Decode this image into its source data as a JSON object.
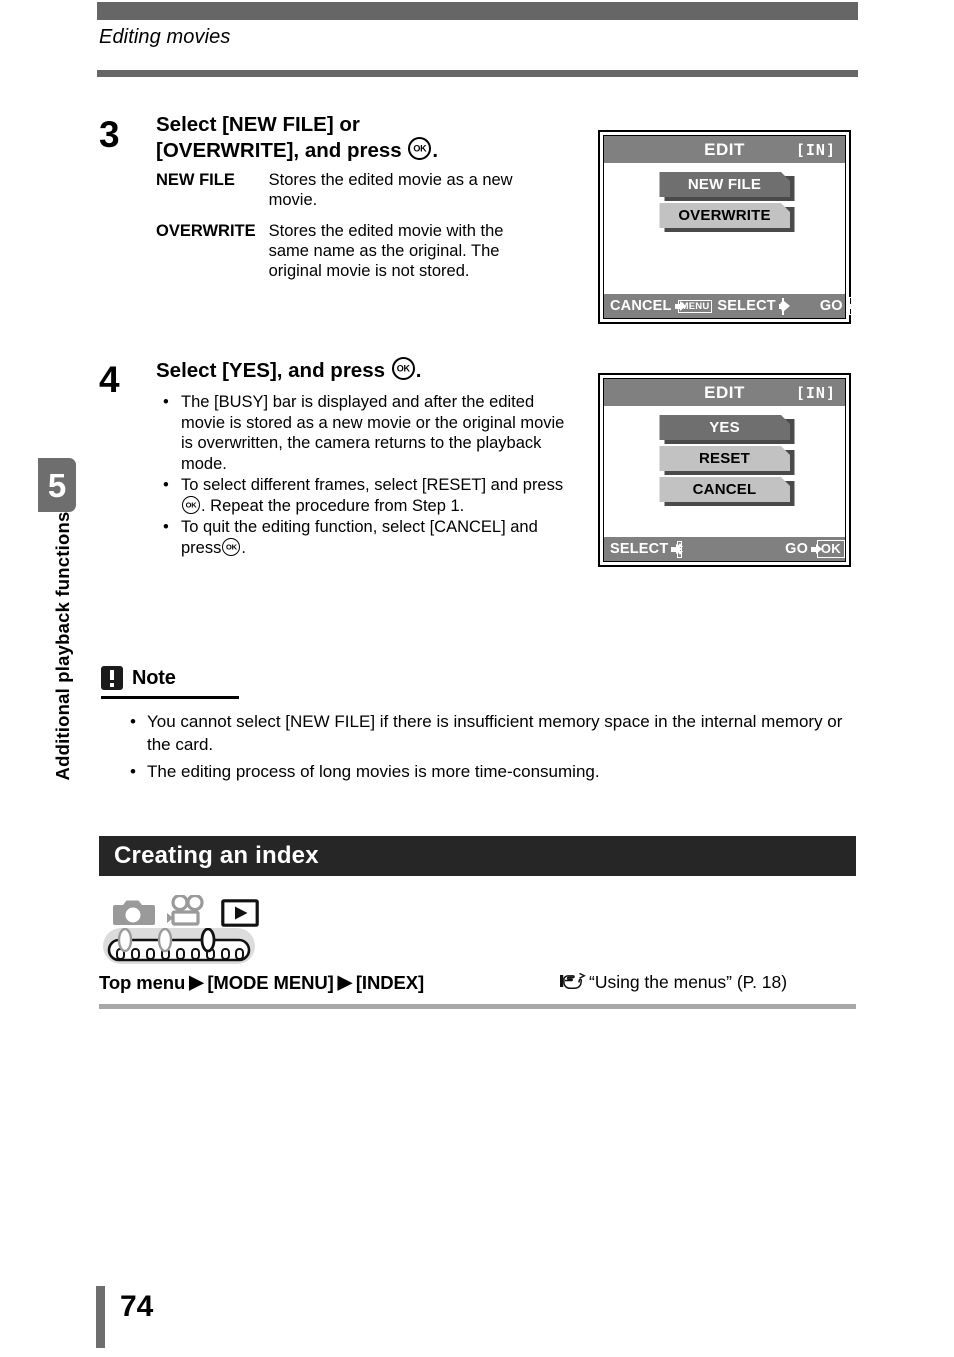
{
  "header": {
    "running_head": "Editing movies"
  },
  "sidebar": {
    "chapter_number": "5",
    "chapter_label": "Additional playback functions"
  },
  "steps": [
    {
      "number": "3",
      "title_line1": "Select [NEW FILE] or",
      "title_line2_a": "[OVERWRITE], and press",
      "title_line2_b": ".",
      "definitions": [
        {
          "term": "NEW FILE",
          "desc": "Stores the edited movie as a new movie."
        },
        {
          "term": "OVERWRITE",
          "desc": "Stores the edited movie with the same name as the original. The original movie is not stored."
        }
      ]
    },
    {
      "number": "4",
      "title_a": "Select [YES], and press",
      "title_b": ".",
      "bullets": [
        "The [BUSY] bar is displayed and after the edited movie is stored as a new movie or the original movie is overwritten, the camera returns to the playback mode.",
        "To select different frames, select [RESET] and press ⒪. Repeat the procedure from Step 1.",
        "To quit the editing function, select [CANCEL] and press ⒪."
      ],
      "bullet2_pre": "To select different frames, select [RESET] and press",
      "bullet2_post": ". Repeat the procedure from Step 1.",
      "bullet3_pre": "To quit the editing function, select [CANCEL] and press",
      "bullet3_post": "."
    }
  ],
  "lcd_screens": [
    {
      "title": "EDIT",
      "memory_indicator": "[IN]",
      "items": [
        {
          "label": "NEW FILE",
          "selected": true
        },
        {
          "label": "OVERWRITE",
          "selected": false
        }
      ],
      "status": {
        "cancel_label": "CANCEL",
        "menu_badge": "MENU",
        "select_label": "SELECT",
        "go_label": "GO",
        "ok_badge": "OK"
      }
    },
    {
      "title": "EDIT",
      "memory_indicator": "[IN]",
      "items": [
        {
          "label": "YES",
          "selected": true
        },
        {
          "label": "RESET",
          "selected": false
        },
        {
          "label": "CANCEL",
          "selected": false
        }
      ],
      "status": {
        "select_label": "SELECT",
        "go_label": "GO",
        "ok_badge": "OK"
      }
    }
  ],
  "note": {
    "title": "Note",
    "bullets": [
      "You cannot select [NEW FILE] if there is insufficient memory space in the internal memory or the card.",
      "The editing process of long movies is more time-consuming."
    ]
  },
  "section": {
    "heading": "Creating an index",
    "mode_icons": [
      "still-camera-icon",
      "movie-camera-icon",
      "playback-icon"
    ],
    "menu_path_1": "Top menu",
    "menu_path_2": "[MODE MENU]",
    "menu_path_3": "[INDEX]",
    "reference": "“Using the menus” (P. 18)"
  },
  "footer": {
    "page_number": "74"
  },
  "colors": {
    "rule_dark": "#666666",
    "rule_light": "#a8a8a8",
    "section_bar": "#262626",
    "lcd_title_gray": "#808080",
    "menu_selected": "#6f6f6f",
    "menu_unselected": "#c2c2c2"
  },
  "bullet_char": "•",
  "triangle_char": "▶"
}
